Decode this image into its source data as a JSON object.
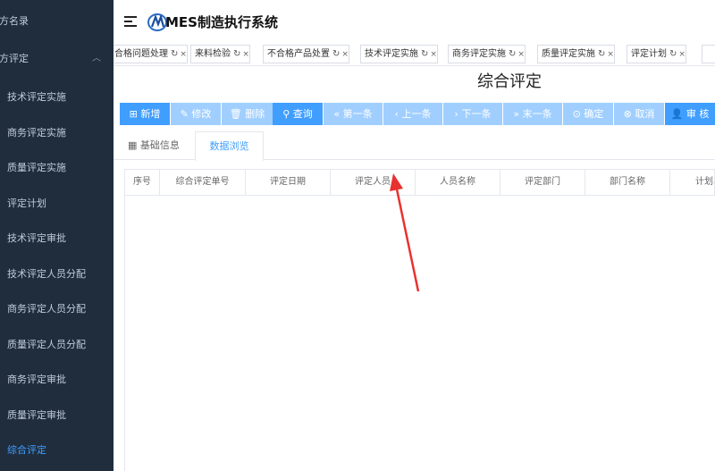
{
  "sidebar": {
    "items": [
      {
        "label": "技术评定实施"
      },
      {
        "label": "商务评定实施"
      },
      {
        "label": "质量评定实施"
      },
      {
        "label": "评定计划"
      },
      {
        "label": "技术评定审批"
      },
      {
        "label": "技术评定人员分配"
      },
      {
        "label": "商务评定人员分配"
      },
      {
        "label": "质量评定人员分配"
      },
      {
        "label": "商务评定审批"
      },
      {
        "label": "质量评定审批"
      },
      {
        "label": "综合评定"
      }
    ],
    "group_top": "供方名录",
    "group_open": "供方评定",
    "active_index": 10
  },
  "header": {
    "app_title": "MES制造执行系统"
  },
  "tabs": [
    {
      "label": "合格问题处理"
    },
    {
      "label": "来料检验"
    },
    {
      "label": "不合格产品处置"
    },
    {
      "label": "技术评定实施"
    },
    {
      "label": "商务评定实施"
    },
    {
      "label": "质量评定实施"
    },
    {
      "label": "评定计划"
    }
  ],
  "page": {
    "title": "综合评定"
  },
  "toolbar": {
    "buttons": [
      {
        "label": "新增",
        "icon": "plus-square-icon"
      },
      {
        "label": "修改",
        "icon": "edit-icon"
      },
      {
        "label": "删除",
        "icon": "trash-icon"
      },
      {
        "label": "查询",
        "icon": "search-icon"
      },
      {
        "label": "第一条",
        "icon": "double-left-icon"
      },
      {
        "label": "上一条",
        "icon": "left-icon"
      },
      {
        "label": "下一条",
        "icon": "right-icon"
      },
      {
        "label": "末一条",
        "icon": "double-right-icon"
      },
      {
        "label": "确定",
        "icon": "check-circle-icon"
      },
      {
        "label": "取消",
        "icon": "close-circle-icon"
      },
      {
        "label": "审 核",
        "icon": "user-icon"
      }
    ]
  },
  "subtabs": [
    {
      "label": "基础信息"
    },
    {
      "label": "数据浏览"
    }
  ],
  "grid": {
    "columns": [
      "序号",
      "综合评定单号",
      "评定日期",
      "评定人员",
      "人员名称",
      "评定部门",
      "部门名称",
      "计划单号"
    ]
  },
  "colors": {
    "sidebar_bg": "#1f2d3d",
    "accent": "#409eff",
    "accent_light": "#a0cfff",
    "annotation_arrow": "#e8322f"
  }
}
